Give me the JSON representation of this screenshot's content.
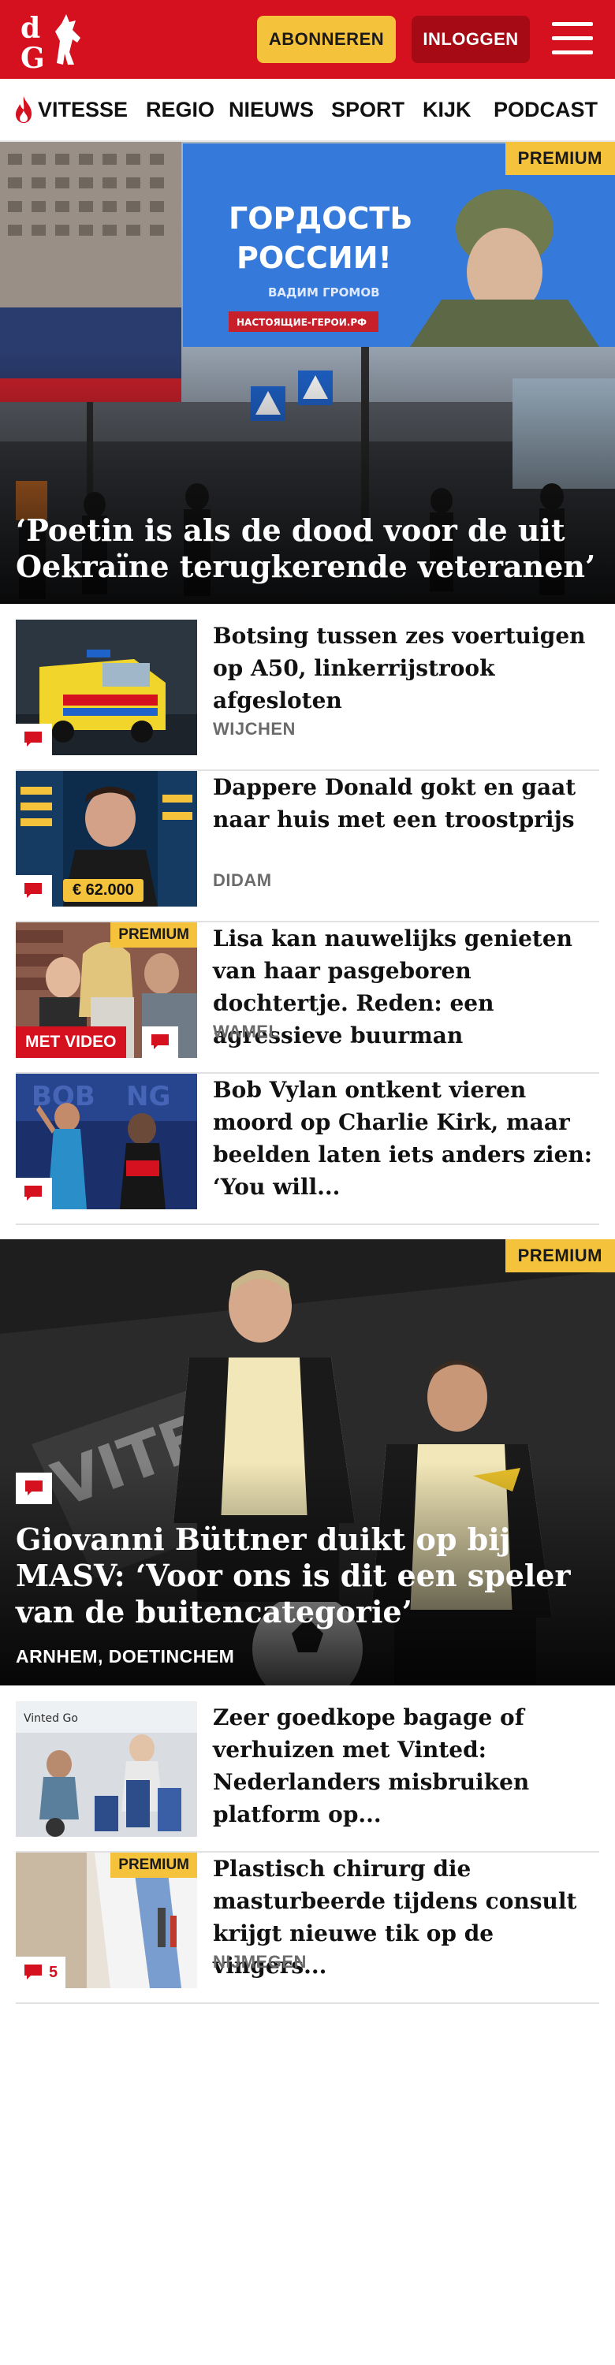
{
  "header": {
    "logo_text": "dG",
    "subscribe_label": "ABONNEREN",
    "login_label": "INLOGGEN",
    "menu_icon": "hamburger-icon",
    "brand_color": "#d5101f"
  },
  "nav": {
    "items": [
      {
        "label": "VITESSE",
        "icon": "flame-icon"
      },
      {
        "label": "REGIO"
      },
      {
        "label": "NIEUWS"
      },
      {
        "label": "SPORT"
      },
      {
        "label": "KIJK"
      },
      {
        "label": "PODCAST"
      }
    ]
  },
  "hero1": {
    "badge": "PREMIUM",
    "title": "‘Poetin is als de dood voor de uit Oekraïne terugkerende veteranen’",
    "billboard_line1": "ГОРДОСТЬ",
    "billboard_line2": "РОССИИ!",
    "billboard_name": "ВАДИМ ГРОМОВ",
    "billboard_site": "НАСТОЯЩИЕ-ГЕРОИ.РФ"
  },
  "articles1": [
    {
      "title": "Botsing tussen zes voertuigen op A50, linkerrijstrook afgesloten",
      "location": "WIJCHEN"
    },
    {
      "title": "Dappere Donald gokt en gaat naar huis met een troostprijs",
      "location": "DIDAM",
      "thumb_text": "€ 62.000"
    },
    {
      "title": "Lisa kan nauwelijks genieten van haar pasgeboren dochtertje. Reden: een agressieve buurman",
      "location": "WAMEL",
      "badge": "PREMIUM",
      "video_label": "MET VIDEO"
    },
    {
      "title": "Bob Vylan ontkent vieren moord op Charlie Kirk, maar beelden laten iets anders zien: ‘You will...",
      "location": ""
    }
  ],
  "hero2": {
    "badge": "PREMIUM",
    "title": "Giovanni Büttner duikt op bij MASV: ‘Voor ons is dit een speler van de buitencategorie’",
    "location": "ARNHEM, DOETINCHEM"
  },
  "articles2": [
    {
      "title": "Zeer goedkope bagage of verhuizen met Vinted: Nederlan­ders misbruiken platform op...",
      "location": ""
    },
    {
      "title": "Plastisch chirurg die masturbeerde tijdens consult krijgt nieuwe tik op de vingers...",
      "location": "NIJMEGEN",
      "badge": "PREMIUM",
      "comments": "5"
    }
  ]
}
